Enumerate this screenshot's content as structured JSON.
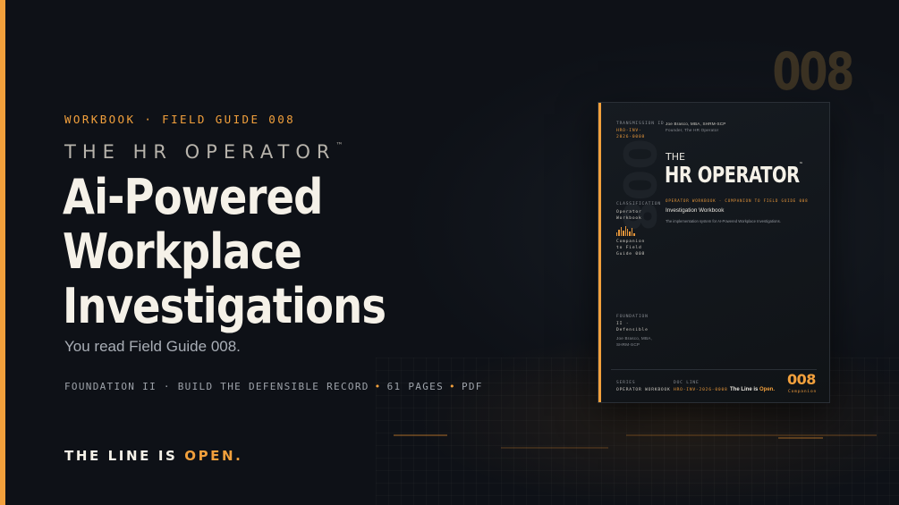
{
  "big_number": "008",
  "eyebrow": "WORKBOOK · FIELD GUIDE 008",
  "brand": {
    "name": "THE HR OPERATOR",
    "mark": "™"
  },
  "headline": [
    "Ai-Powered",
    "Workplace",
    "Investigations"
  ],
  "subline": "You read Field Guide 008.",
  "meta": {
    "series": "FOUNDATION II · BUILD THE DEFENSIBLE RECORD",
    "pages": "61 PAGES",
    "format": "PDF",
    "separator": "•"
  },
  "tagline": {
    "prefix": "THE LINE IS",
    "emphasis": "OPEN."
  },
  "colors": {
    "accent": "#f2a03c",
    "background": "#0e1117",
    "text": "#f5f1e8"
  },
  "cover": {
    "transmission_label": "TRANSMISSION ID",
    "transmission_id": "HRO-INV-2026-0008",
    "author": "Joe Brasco, MBA, SHRM-SCP",
    "author_role": "Founder, The HR Operator",
    "classification_label": "CLASSIFICATION",
    "classification": "Operator Workbook",
    "companion": "Companion to Field Guide 008",
    "the": "THE",
    "title": "HR OPERATOR",
    "title_mark": "™",
    "series_line": "OPERATOR WORKBOOK · COMPANION TO FIELD GUIDE 008",
    "subhead": "Investigation Workbook",
    "description": "The implementation system for AI-Powered Workplace Investigations.",
    "foundation_label": "FOUNDATION",
    "foundation": "II · Defensible",
    "foundation_author": "Joe Brasco, MBA, SHRM-SCP",
    "footer_series_label": "SERIES",
    "footer_series": "OPERATOR WORKBOOK",
    "footer_doc_label": "DOC LINE",
    "footer_doc": "HRO-INV-2026-0008",
    "footer_line_prefix": "The Line is",
    "footer_line_emphasis": "Open.",
    "footer_number": "008",
    "footer_number_caption": "Companion"
  }
}
